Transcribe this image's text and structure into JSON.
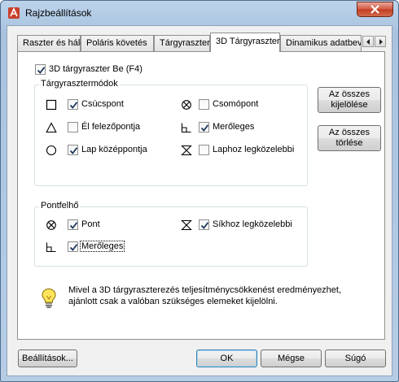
{
  "window": {
    "title": "Rajzbeállítások"
  },
  "tabs": [
    {
      "label": "Raszter és háló"
    },
    {
      "label": "Poláris követés"
    },
    {
      "label": "Tárgyraszter"
    },
    {
      "label": "3D Tárgyraszter",
      "active": true
    },
    {
      "label": "Dinamikus adatbevit"
    }
  ],
  "main_toggle": {
    "label": "3D tárgyraszter Be (F4)",
    "checked": true
  },
  "modes_group": {
    "title": "Tárgyrasztermódok",
    "items": [
      {
        "label": "Csúcspont",
        "checked": true,
        "icon": "square-marker-icon"
      },
      {
        "label": "Csomópont",
        "checked": false,
        "icon": "node-marker-icon"
      },
      {
        "label": "Él felezőpontja",
        "checked": false,
        "icon": "triangle-marker-icon"
      },
      {
        "label": "Merőleges",
        "checked": true,
        "icon": "perpendicular-marker-icon"
      },
      {
        "label": "Lap középpontja",
        "checked": true,
        "icon": "circle-marker-icon"
      },
      {
        "label": "Laphoz legközelebbi",
        "checked": false,
        "icon": "hourglass-marker-icon"
      }
    ]
  },
  "pointcloud_group": {
    "title": "Pontfelhő",
    "items": [
      {
        "label": "Pont",
        "checked": true,
        "icon": "node-marker-icon"
      },
      {
        "label": "Síkhoz legközelebbi",
        "checked": true,
        "icon": "hourglass-marker-icon"
      },
      {
        "label": "Merőleges",
        "checked": true,
        "icon": "perpendicular-marker-icon"
      }
    ]
  },
  "side_buttons": {
    "select_all": "Az összes kijelölése",
    "clear_all": "Az összes törlése"
  },
  "info_text": "Mivel a 3D tárgyraszterezés teljesítménycsökkenést eredményezhet, ajánlott csak a valóban szükséges elemeket kijelölni.",
  "footer": {
    "options": "Beállítások...",
    "ok": "OK",
    "cancel": "Mégse",
    "help": "Súgó"
  },
  "colors": {
    "accent": "#3c7fb1",
    "check": "#1e395b",
    "close": "#c23c23"
  }
}
